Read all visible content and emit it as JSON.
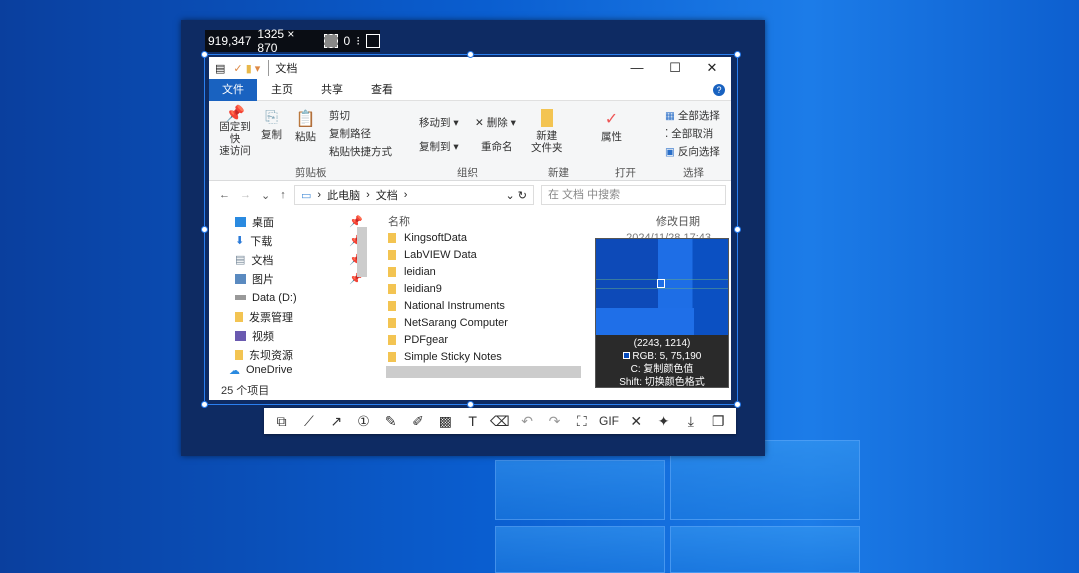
{
  "info_bar": {
    "position": "919,347",
    "size": "1325 × 870",
    "radius": "0"
  },
  "explorer": {
    "title": "文档",
    "window_buttons": {
      "minimize": "—",
      "maximize": "☐",
      "close": "✕"
    },
    "tabs": [
      "文件",
      "主页",
      "共享",
      "查看"
    ],
    "ribbon": {
      "pin": "固定到快\n速访问",
      "copy": "复制",
      "paste": "粘贴",
      "cut": "剪切",
      "copy_path": "复制路径",
      "paste_shortcut": "粘贴快捷方式",
      "move_to": "移动到 ▾",
      "delete": "✕ 删除 ▾",
      "copy_to": "复制到 ▾",
      "rename": "重命名",
      "new_folder": "新建\n文件夹",
      "properties": "属性",
      "select_all": "全部选择",
      "select_none": "全部取消",
      "invert_selection": "反向选择",
      "groups": [
        "剪贴板",
        "组织",
        "新建",
        "打开",
        "选择"
      ]
    },
    "address": {
      "crumbs": [
        "此电脑",
        "文档"
      ],
      "search_placeholder": "在 文档 中搜索"
    },
    "nav_items": [
      "桌面",
      "下载",
      "文档",
      "图片",
      "Data (D:)",
      "发票管理",
      "视频",
      "东坝资源",
      "OneDrive"
    ],
    "columns": {
      "name": "名称",
      "modified": "修改日期"
    },
    "files": [
      "KingsoftData",
      "LabVIEW Data",
      "leidian",
      "leidian9",
      "National Instruments",
      "NetSarang Computer",
      "PDFgear",
      "Simple Sticky Notes"
    ],
    "first_date": "2024/11/28 17:43",
    "status": "25 个项目"
  },
  "magnifier": {
    "coords": "(2243, 1214)",
    "rgb": "RGB:   5, 75,190",
    "hint_copy": "C: 复制颜色值",
    "hint_shift": "Shift: 切换颜色格式",
    "color": "#054bbe"
  },
  "toolbar": {
    "gif": "GIF"
  }
}
